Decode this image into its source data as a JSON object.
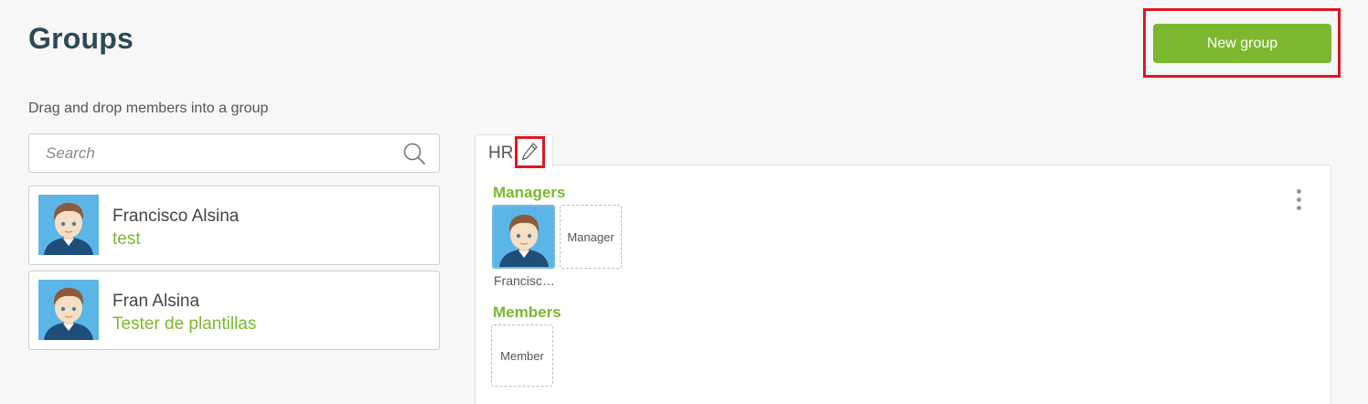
{
  "header": {
    "title": "Groups",
    "new_group_label": "New group"
  },
  "instructions": "Drag and drop members into a group",
  "search": {
    "placeholder": "Search"
  },
  "members": [
    {
      "name": "Francisco Alsina",
      "role": "test",
      "avatar": "user-avatar-icon"
    },
    {
      "name": "Fran Alsina",
      "role": "Tester de plantillas",
      "avatar": "user-avatar-icon"
    }
  ],
  "group": {
    "name": "HR",
    "edit_icon": "pencil-icon",
    "menu_icon": "kebab-menu-icon",
    "managers_label": "Managers",
    "manager_caption": "Francisc…",
    "manager_slot_label": "Manager",
    "members_label": "Members",
    "member_slot_label": "Member"
  },
  "colors": {
    "accent_green": "#7cb82f",
    "title": "#2d4a55",
    "highlight": "#e0171f"
  }
}
